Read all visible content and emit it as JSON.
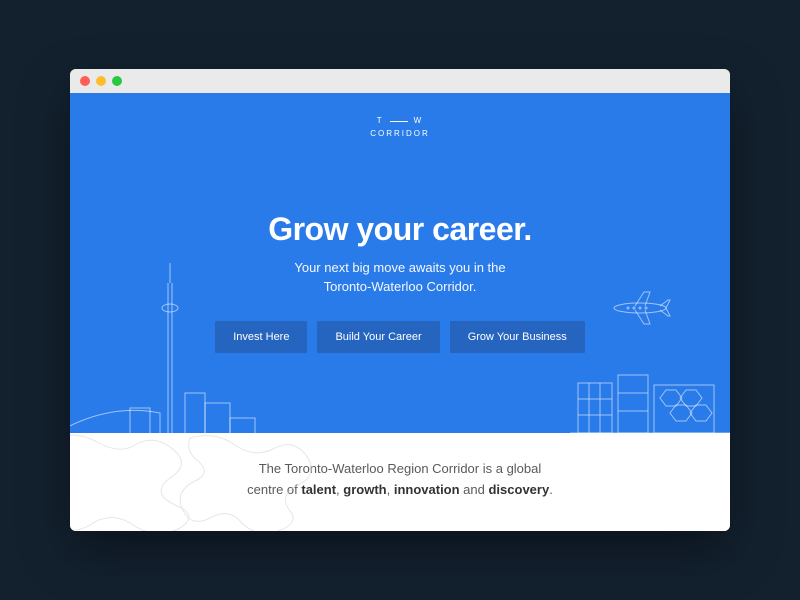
{
  "logo": {
    "left": "T",
    "right": "W",
    "bottom": "CORRIDOR"
  },
  "hero": {
    "headline": "Grow your career.",
    "subhead_line1": "Your next big move awaits you in the",
    "subhead_line2": "Toronto-Waterloo Corridor."
  },
  "cta": {
    "invest": "Invest Here",
    "career": "Build Your Career",
    "business": "Grow Your Business"
  },
  "below": {
    "line1_pre": "The Toronto-Waterloo Region Corridor is a global",
    "line2_pre": "centre of ",
    "talent": "talent",
    "sep1": ", ",
    "growth": "growth",
    "sep2": ", ",
    "innovation": "innovation",
    "sep3": " and ",
    "discovery": "discovery",
    "end": "."
  },
  "colors": {
    "accent": "#2a7bea",
    "button": "#2665bf"
  }
}
